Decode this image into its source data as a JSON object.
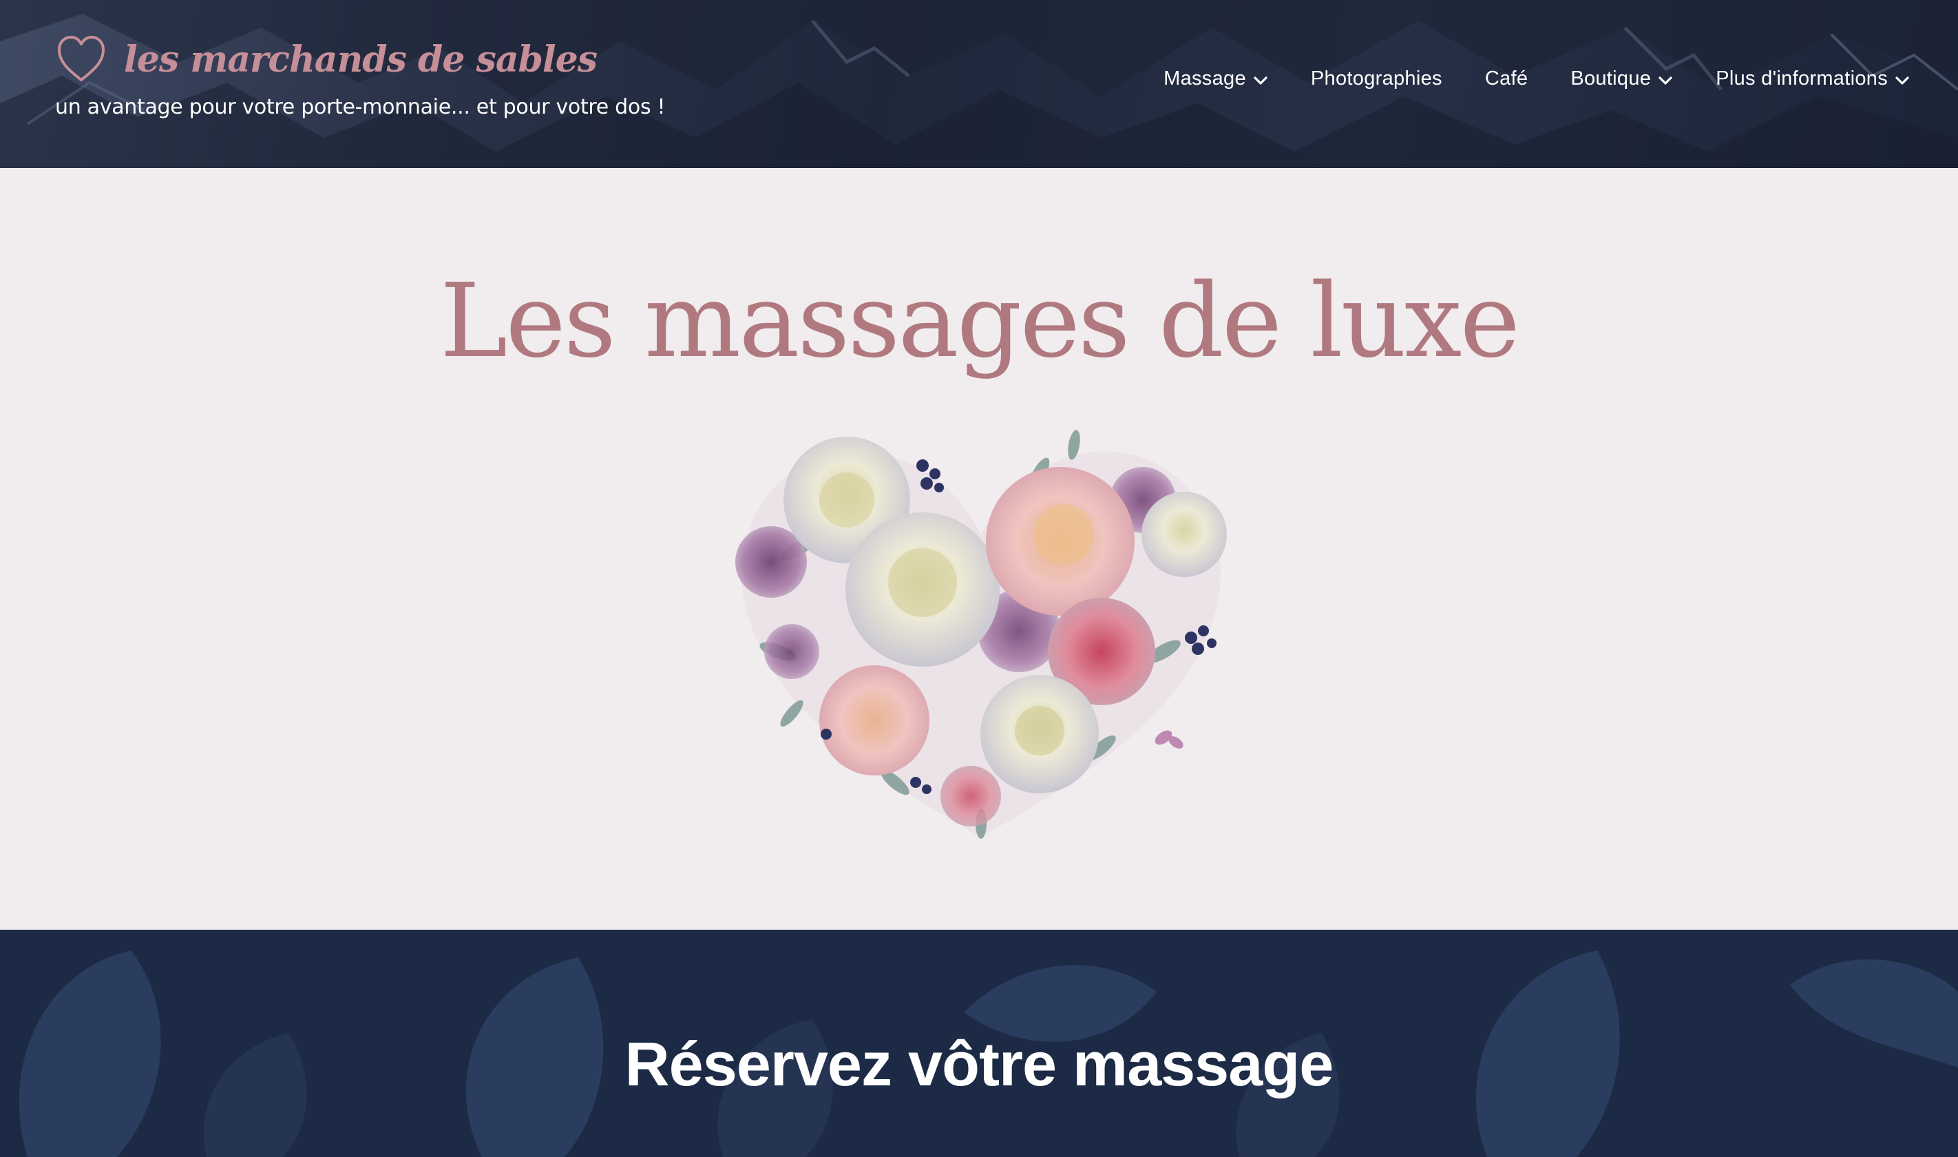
{
  "brand": {
    "name": "les marchands de sables",
    "tagline": "un avantage pour votre porte-monnaie... et pour votre dos !",
    "logo_icon": "heart-outline-icon"
  },
  "nav": {
    "items": [
      {
        "label": "Massage",
        "has_dropdown": true
      },
      {
        "label": "Photographies",
        "has_dropdown": false
      },
      {
        "label": "Café",
        "has_dropdown": false
      },
      {
        "label": "Boutique",
        "has_dropdown": true
      },
      {
        "label": "Plus d'informations",
        "has_dropdown": true
      }
    ]
  },
  "hero": {
    "title": "Les massages de luxe",
    "image": "floral-heart-bouquet"
  },
  "reserve": {
    "title": "Réservez vôtre massage"
  },
  "colors": {
    "accent_pink": "#b0797f",
    "brand_pink": "#c68f98",
    "header_navy": "#262f45",
    "section_navy": "#1c2a45",
    "page_bg": "#f1ecee"
  }
}
